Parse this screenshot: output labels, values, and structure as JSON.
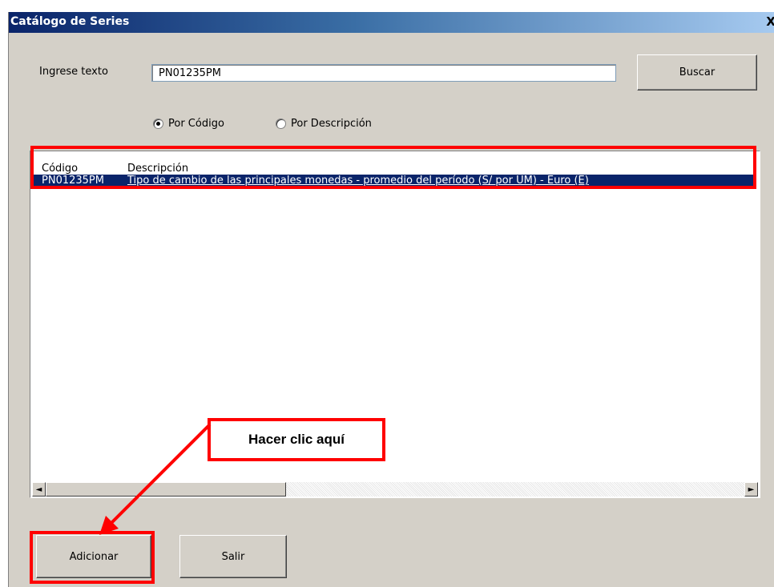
{
  "window": {
    "title": "Catálogo de Series",
    "close_label": "X"
  },
  "search": {
    "label": "Ingrese texto",
    "value": "PN01235PM",
    "button_label": "Buscar"
  },
  "filter": {
    "options": [
      {
        "label": "Por Código",
        "selected": true
      },
      {
        "label": "Por Descripción",
        "selected": false
      }
    ]
  },
  "list": {
    "headers": [
      "Código",
      "Descripción"
    ],
    "rows": [
      {
        "codigo": "PN01235PM",
        "descripcion": "Tipo de cambio de las principales monedas - promedio del período (S/ por UM) - Euro (E)",
        "selected": true
      }
    ]
  },
  "buttons": {
    "add_label": "Adicionar",
    "exit_label": "Salir"
  },
  "annotation": {
    "callout_text": "Hacer clic aquí",
    "highlight_color": "#ff0000"
  },
  "icons": {
    "scroll_left": "◄",
    "scroll_right": "►"
  }
}
